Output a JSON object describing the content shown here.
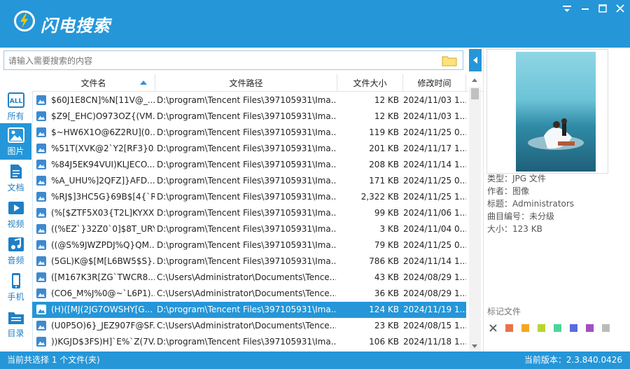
{
  "app": {
    "title": "闪电搜索"
  },
  "search": {
    "placeholder": "请输入需要搜索的内容",
    "value": ""
  },
  "sidebar": {
    "items": [
      {
        "label": "所有",
        "icon": "all-icon"
      },
      {
        "label": "图片",
        "icon": "image-icon",
        "active": true
      },
      {
        "label": "文档",
        "icon": "document-icon"
      },
      {
        "label": "视频",
        "icon": "video-icon"
      },
      {
        "label": "音频",
        "icon": "audio-icon"
      },
      {
        "label": "手机",
        "icon": "phone-icon"
      },
      {
        "label": "目录",
        "icon": "folder-list-icon"
      }
    ]
  },
  "table": {
    "columns": [
      "文件名",
      "文件路径",
      "文件大小",
      "修改时间"
    ],
    "rows": [
      {
        "name": "$60J1E8CN]%N[11V@_...",
        "path": "D:\\program\\Tencent Files\\397105931\\Ima...",
        "size": "12 KB",
        "time": "2024/11/03 1..."
      },
      {
        "name": "$Z9[_EHC)O973OZ{(VM...",
        "path": "D:\\program\\Tencent Files\\397105931\\Ima...",
        "size": "12 KB",
        "time": "2024/11/03 1..."
      },
      {
        "name": "$~HW6X1O@6Z2RU](0...",
        "path": "D:\\program\\Tencent Files\\397105931\\Ima...",
        "size": "119 KB",
        "time": "2024/11/25 0..."
      },
      {
        "name": "%51T(XVK@2`Y2[RF3}0...",
        "path": "D:\\program\\Tencent Files\\397105931\\Ima...",
        "size": "201 KB",
        "time": "2024/11/17 1..."
      },
      {
        "name": "%84J5EK94VUI)KLJECO...",
        "path": "D:\\program\\Tencent Files\\397105931\\Ima...",
        "size": "208 KB",
        "time": "2024/11/14 1..."
      },
      {
        "name": "%A_UHU%]2QFZ]}AFD...",
        "path": "D:\\program\\Tencent Files\\397105931\\Ima...",
        "size": "171 KB",
        "time": "2024/11/25 0..."
      },
      {
        "name": "%RJ$]3HC5G}69B$[4{`R...",
        "path": "D:\\program\\Tencent Files\\397105931\\Ima...",
        "size": "2,322 KB",
        "time": "2024/11/25 1..."
      },
      {
        "name": "(%[$ZTF5X03{T2L]KYXX...",
        "path": "D:\\program\\Tencent Files\\397105931\\Ima...",
        "size": "99 KB",
        "time": "2024/11/06 1..."
      },
      {
        "name": "((%EZ`}32Z0`0]$8T_URY...",
        "path": "D:\\program\\Tencent Files\\397105931\\Ima...",
        "size": "3 KB",
        "time": "2024/11/04 0..."
      },
      {
        "name": "((@S%9JWZPDJ%Q}QM...",
        "path": "D:\\program\\Tencent Files\\397105931\\Ima...",
        "size": "79 KB",
        "time": "2024/11/25 0..."
      },
      {
        "name": "(5GL)K@$[M[L6BW5$S}...",
        "path": "D:\\program\\Tencent Files\\397105931\\Ima...",
        "size": "786 KB",
        "time": "2024/11/14 1..."
      },
      {
        "name": "([M167K3R[ZG`TWCR8...",
        "path": "C:\\Users\\Administrator\\Documents\\Tence...",
        "size": "43 KB",
        "time": "2024/08/29 1..."
      },
      {
        "name": "(CO6_M%J%0@~`L6P1)...",
        "path": "C:\\Users\\Administrator\\Documents\\Tence...",
        "size": "36 KB",
        "time": "2024/08/29 1..."
      },
      {
        "name": "(H)([MJ(2JG7OWSHY[G...",
        "path": "D:\\program\\Tencent Files\\397105931\\Ima...",
        "size": "124 KB",
        "time": "2024/11/19 1...",
        "selected": true
      },
      {
        "name": "(U0P5O)6}_JEZ907F@SF...",
        "path": "C:\\Users\\Administrator\\Documents\\Tence...",
        "size": "23 KB",
        "time": "2024/08/15 1..."
      },
      {
        "name": "))KGJD$3FS)H]`E%`Z(7V...",
        "path": "D:\\program\\Tencent Files\\397105931\\Ima...",
        "size": "106 KB",
        "time": "2024/11/18 1..."
      }
    ]
  },
  "details": [
    "类型：JPG 文件",
    "作者：图像",
    "标题：Administrators",
    "曲目编号：未分级",
    "大小：123 KB"
  ],
  "tags": {
    "title": "标记文件",
    "colors": [
      "#e8734a",
      "#f5a623",
      "#b8d432",
      "#4cd59a",
      "#5a6be0",
      "#a24fc0",
      "#bbbbbb"
    ]
  },
  "status": {
    "left": "当前共选择 1 个文件(夹)",
    "right": "当前版本：2.3.840.0426"
  }
}
